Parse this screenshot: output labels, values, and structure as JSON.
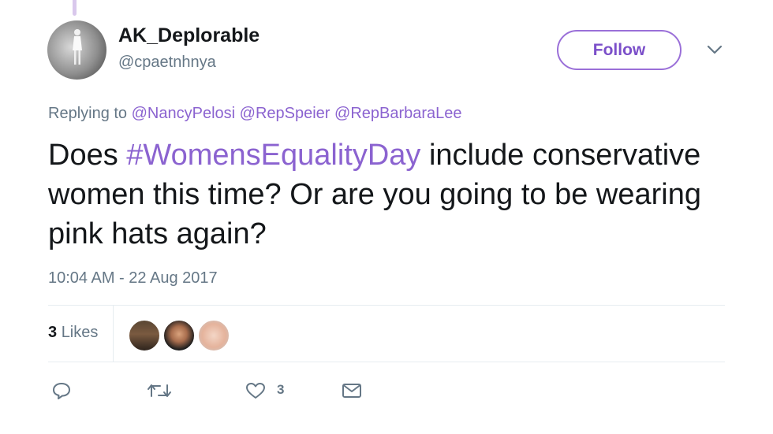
{
  "user": {
    "display_name": "AK_Deplorable",
    "handle": "@cpaetnhnya",
    "follow_label": "Follow"
  },
  "tweet": {
    "replying_prefix": "Replying to",
    "replying_to": [
      "@NancyPelosi",
      "@RepSpeier",
      "@RepBarbaraLee"
    ],
    "text_before": "Does ",
    "hashtag": "#WomensEqualityDay",
    "text_after": " include conservative women this time? Or are you going to be wearing pink hats again?",
    "timestamp": "10:04 AM - 22 Aug 2017"
  },
  "stats": {
    "likes_count": "3",
    "likes_label": "Likes"
  },
  "actions": {
    "reply_icon": "reply-icon",
    "retweet_icon": "retweet-icon",
    "like_icon": "heart-icon",
    "like_count": "3",
    "dm_icon": "envelope-icon"
  },
  "colors": {
    "accent": "#8b63d0",
    "text": "#14171a",
    "muted": "#657786",
    "divider": "#e6ecf0"
  }
}
